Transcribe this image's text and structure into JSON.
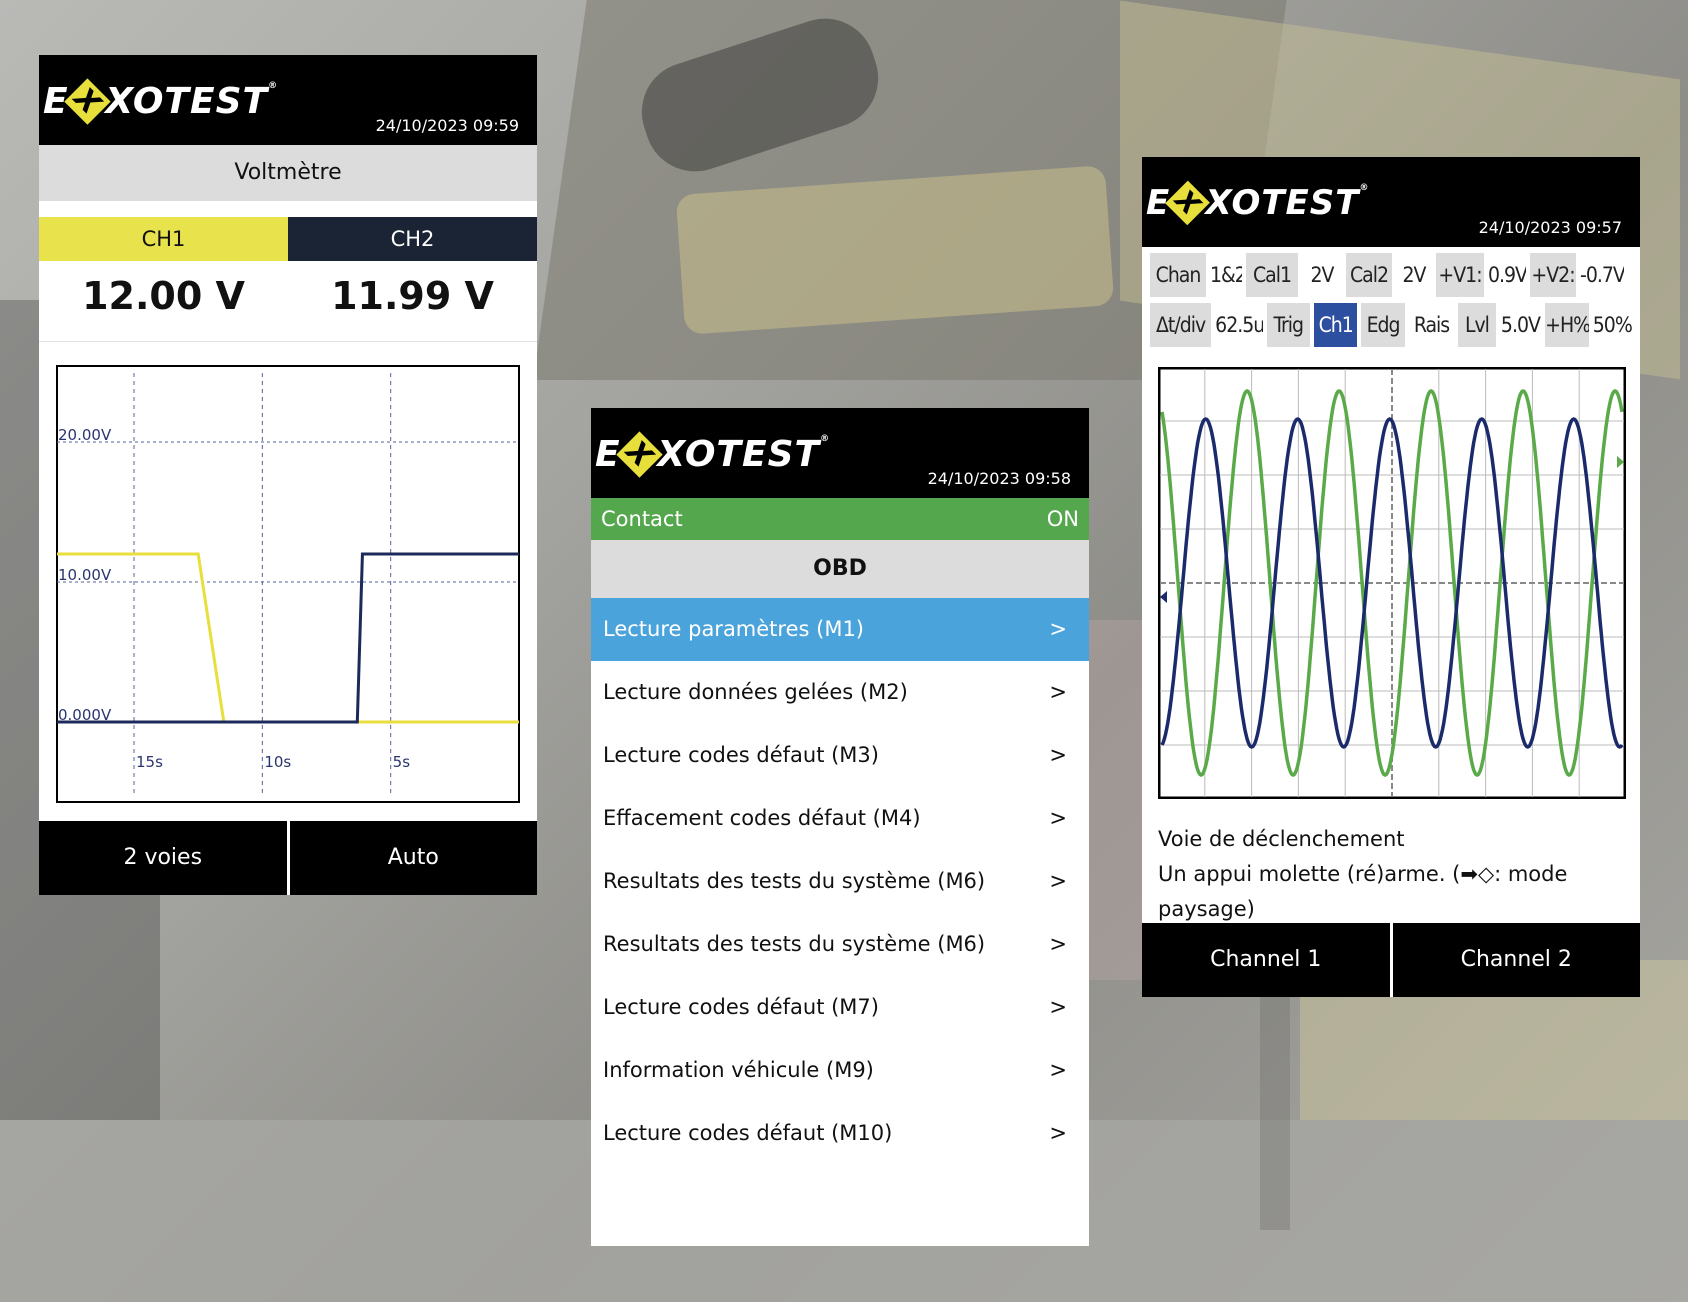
{
  "brand": {
    "logo_text": "EXXOTEST"
  },
  "voltmeter": {
    "datetime": "24/10/2023 09:59",
    "title": "Voltmètre",
    "ch1_label": "CH1",
    "ch2_label": "CH2",
    "ch1_value": "12.00 V",
    "ch2_value": "11.99 V",
    "btn_left": "2 voies",
    "btn_right": "Auto",
    "colors": {
      "ch1": "#e8de3c",
      "ch2": "#1b2a5a"
    }
  },
  "obd": {
    "datetime": "24/10/2023 09:58",
    "contact_label": "Contact",
    "contact_state": "ON",
    "title": "OBD",
    "items": [
      {
        "label": "Lecture paramètres (M1)",
        "chevron": ">"
      },
      {
        "label": "Lecture données gelées (M2)",
        "chevron": ">"
      },
      {
        "label": "Lecture codes défaut (M3)",
        "chevron": ">"
      },
      {
        "label": "Effacement codes défaut (M4)",
        "chevron": ">"
      },
      {
        "label": "Resultats des tests du système (M6)",
        "chevron": ">"
      },
      {
        "label": "Resultats des tests du système (M6)",
        "chevron": ">"
      },
      {
        "label": "Lecture codes défaut (M7)",
        "chevron": ">"
      },
      {
        "label": "Information véhicule (M9)",
        "chevron": ">"
      },
      {
        "label": "Lecture codes défaut (M10)",
        "chevron": ">"
      }
    ],
    "colors": {
      "contact": "#55a74e",
      "selected": "#4ba3dc"
    }
  },
  "scope": {
    "datetime": "24/10/2023 09:57",
    "row1": [
      "Chan",
      "1&2",
      "Cal1",
      "2V",
      "Cal2",
      "2V",
      "+V1:",
      "0.9V",
      "+V2:",
      "-0.7V"
    ],
    "row2": [
      "Δt/div",
      "62.5u",
      "Trig",
      "Ch1",
      "Edg",
      "Rais",
      "Lvl",
      "5.0V",
      "+H%",
      "50%"
    ],
    "note_line1": "Voie de déclenchement",
    "note_line2": " Un appui molette (ré)arme. (➡◇: mode paysage)",
    "btn_left": "Channel 1",
    "btn_right": "Channel 2",
    "colors": {
      "ch1": "#5aaa4a",
      "ch2": "#1b2a6a"
    }
  },
  "chart_data": [
    {
      "type": "line",
      "ylabels": [
        "20.00V",
        "10.00V",
        "0.000V"
      ],
      "xlabels": [
        "15s",
        "10s",
        "5s"
      ],
      "x_range": [
        18,
        0
      ],
      "ylim": [
        0,
        25
      ],
      "series": [
        {
          "x": [
            18,
            12.5,
            11.5,
            0
          ],
          "y": [
            12,
            12,
            0,
            0
          ]
        },
        {
          "x": [
            18,
            6.3,
            6.1,
            0
          ],
          "y": [
            0,
            0,
            12,
            12
          ]
        }
      ]
    },
    {
      "type": "line",
      "grid": true,
      "periods": 5,
      "series": [
        {
          "amplitude": 0.96,
          "phase": 0.05
        },
        {
          "amplitude": 0.82,
          "phase": 0.95
        }
      ]
    }
  ]
}
